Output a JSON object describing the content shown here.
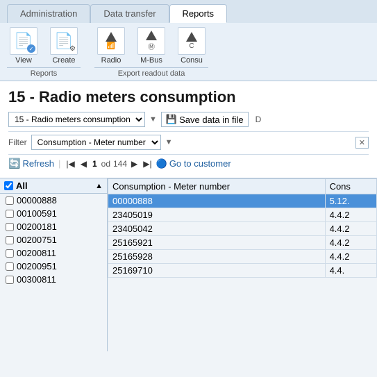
{
  "tabs": [
    {
      "id": "administration",
      "label": "Administration",
      "active": false
    },
    {
      "id": "data-transfer",
      "label": "Data transfer",
      "active": false
    },
    {
      "id": "reports",
      "label": "Reports",
      "active": true
    }
  ],
  "toolbar": {
    "reports_group": {
      "label": "Reports",
      "icons": [
        {
          "id": "view",
          "label": "View",
          "icon": "📄",
          "badge": "check"
        },
        {
          "id": "create",
          "label": "Create",
          "icon": "📄",
          "badge": "gear"
        }
      ]
    },
    "export_group": {
      "label": "Export readout data",
      "icons": [
        {
          "id": "radio",
          "label": "Radio",
          "icon": "↑",
          "badge": "wifi"
        },
        {
          "id": "mbus",
          "label": "M-Bus",
          "icon": "↑",
          "badge": "m"
        },
        {
          "id": "consu",
          "label": "Consu",
          "icon": "↑",
          "badge": ""
        }
      ]
    }
  },
  "page": {
    "title": "15 - Radio meters consumption",
    "dropdown_value": "15 - Radio meters consumption",
    "save_btn_label": "Save data in file",
    "filter_label": "Filter",
    "filter_value": "Consumption - Meter number",
    "pagination": {
      "refresh_label": "Refresh",
      "current_page": "1",
      "of_label": "od",
      "total_pages": "144",
      "go_customer_label": "Go to customer"
    }
  },
  "list": {
    "all_label": "All",
    "items": [
      "00000888",
      "00100591",
      "00200181",
      "00200751",
      "00200811",
      "00200951",
      "00300811"
    ]
  },
  "table": {
    "columns": [
      "Consumption - Meter number",
      "Cons"
    ],
    "rows": [
      {
        "meter": "00000888",
        "cons": "5.12.",
        "selected": true
      },
      {
        "meter": "23405019",
        "cons": "4.4.2",
        "selected": false
      },
      {
        "meter": "23405042",
        "cons": "4.4.2",
        "selected": false
      },
      {
        "meter": "25165921",
        "cons": "4.4.2",
        "selected": false
      },
      {
        "meter": "25165928",
        "cons": "4.4.2",
        "selected": false
      },
      {
        "meter": "25169710",
        "cons": "4.4.",
        "selected": false
      }
    ]
  }
}
